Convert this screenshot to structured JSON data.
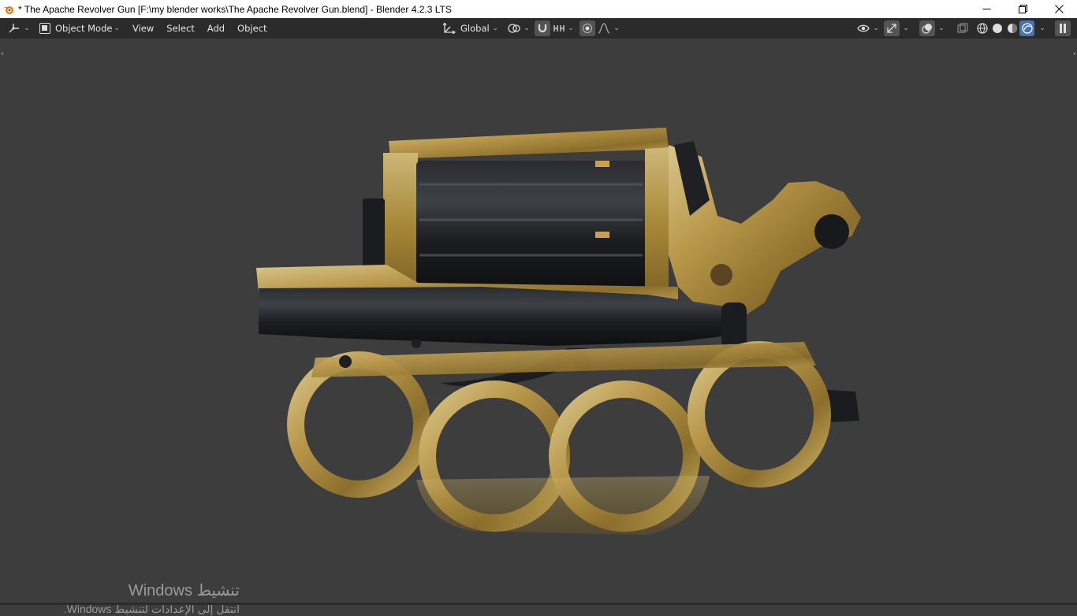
{
  "window": {
    "title": "* The Apache Revolver Gun [F:\\my blender works\\The Apache Revolver Gun.blend] - Blender 4.2.3 LTS"
  },
  "header": {
    "editor_type_icon": "viewport-3d-icon",
    "mode_label": "Object Mode",
    "menus": [
      "View",
      "Select",
      "Add",
      "Object"
    ],
    "orientation_label": "Global",
    "icons": {
      "pivot": "pivot-point-icon",
      "snap": "magnet-icon",
      "snap_increment": "snap-increment-icon",
      "proportional": "proportional-edit-icon",
      "falloff": "falloff-curve-icon",
      "visibility": "eye-icon",
      "gizmo": "gizmo-icon",
      "overlays": "overlays-icon",
      "xray": "xray-icon",
      "shading_modes": [
        "wireframe-shading-icon",
        "solid-shading-icon",
        "material-shading-icon",
        "rendered-shading-icon"
      ],
      "sidebar": "sidebar-toggle-icon"
    },
    "active_shading": "rendered-shading-icon",
    "accent_color": "#4772b3"
  },
  "viewport": {
    "background": "#3d3d3d",
    "object": "revolver-brass-knuckles-model"
  },
  "watermark": {
    "line1": "تنشيط Windows",
    "line2": "انتقل إلى الإعدادات لتنشيط Windows."
  }
}
